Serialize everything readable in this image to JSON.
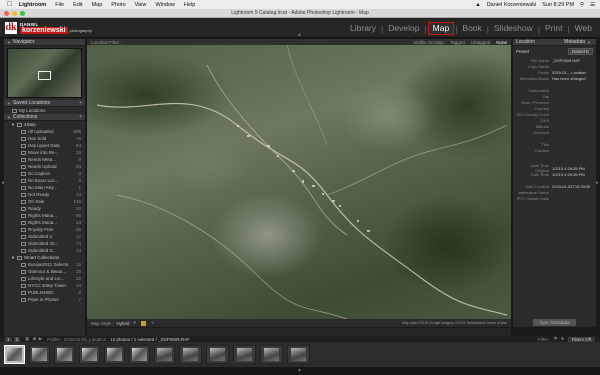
{
  "macbar": {
    "app": "Lightroom",
    "menus": [
      "File",
      "Edit",
      "Map",
      "Photo",
      "View",
      "Window",
      "Help"
    ],
    "user": "Daniel Korzeniewski",
    "time": "Sun 8:29 PM"
  },
  "window": {
    "title": "Lightroom 5 Catalog.lrcat - Adobe Photoshop Lightroom - Map"
  },
  "identity": {
    "line1": "DANIEL",
    "line2": "korzeniewski",
    "line3": "photography",
    "mark": "dk"
  },
  "modules": [
    "Library",
    "Develop",
    "Map",
    "Book",
    "Slideshow",
    "Print",
    "Web"
  ],
  "active_module": "Map",
  "left": {
    "navigator": "Navigator",
    "saved_locations": "Saved Locations",
    "my_locations": "My Locations",
    "collections": "Collections",
    "group1": "4Step",
    "items": [
      {
        "label": "All Uploaded",
        "count": "999"
      },
      {
        "label": "Has Sold",
        "count": "76"
      },
      {
        "label": "Has Upset Data",
        "count": "94"
      },
      {
        "label": "Move into Re...",
        "count": "32"
      },
      {
        "label": "Needs Meta...",
        "count": "9"
      },
      {
        "label": "Needs Upload",
        "count": "34"
      },
      {
        "label": "No Caption",
        "count": "3"
      },
      {
        "label": "No Exact Loc...",
        "count": "5"
      },
      {
        "label": "No Main Key...",
        "count": "1"
      },
      {
        "label": "Not Ready",
        "count": "24"
      },
      {
        "label": "On Sale",
        "count": "146"
      },
      {
        "label": "Ready",
        "count": "20"
      },
      {
        "label": "Rights Mana...",
        "count": "56"
      },
      {
        "label": "Rights Mana...",
        "count": "43"
      },
      {
        "label": "Royalty Free",
        "count": "25"
      },
      {
        "label": "Submitted 2",
        "count": "17"
      },
      {
        "label": "Submitted 20...",
        "count": "74"
      },
      {
        "label": "Submitted D...",
        "count": "14"
      }
    ],
    "group2": "Smart Collections",
    "items2": [
      {
        "label": "Europe2011 Selects",
        "count": "12"
      },
      {
        "label": "Glamour & Beaut...",
        "count": "19"
      },
      {
        "label": "Lifestyle and Lei...",
        "count": "32"
      },
      {
        "label": "NYCC 4step Tower",
        "count": "14"
      },
      {
        "label": "PUBLISHED",
        "count": "8"
      },
      {
        "label": "Pope in Photos",
        "count": "7"
      }
    ],
    "btn_import": "Import...",
    "btn_export": "Export..."
  },
  "map": {
    "filter_label": "Location Filter :",
    "filters": [
      "Visible On Map",
      "Tagged",
      "Untagged",
      "None"
    ],
    "active_filter": "None",
    "map_style_label": "Map Style :",
    "map_style": "Hybrid",
    "attribution": "Map data ©2015 Google Imagery ©2015 TerraMetrics Terms of Use"
  },
  "right": {
    "histogram": "Location",
    "metadata": "Metadata",
    "preset_label": "Preset",
    "preset_value": "Daniel K",
    "rows": [
      {
        "k": "File Name",
        "v": "_DSF0509.RAF"
      },
      {
        "k": "Copy Name",
        "v": ""
      },
      {
        "k": "Folder",
        "v": "2015-01-...Location"
      },
      {
        "k": "Metadata Status",
        "v": "Has been changed"
      },
      {
        "k": "",
        "v": ""
      },
      {
        "k": "Sublocation",
        "v": ""
      },
      {
        "k": "City",
        "v": ""
      },
      {
        "k": "State / Province",
        "v": ""
      },
      {
        "k": "Country",
        "v": ""
      },
      {
        "k": "ISO Country Code",
        "v": ""
      },
      {
        "k": "GPS",
        "v": ""
      },
      {
        "k": "Altitude",
        "v": ""
      },
      {
        "k": "Direction",
        "v": ""
      },
      {
        "k": "",
        "v": ""
      },
      {
        "k": "Title",
        "v": ""
      },
      {
        "k": "Caption",
        "v": ""
      },
      {
        "k": "",
        "v": ""
      },
      {
        "k": "",
        "v": ""
      },
      {
        "k": "Date Time Original",
        "v": "1/2/15 4:29:35 PM"
      },
      {
        "k": "Date Time",
        "v": "1/2/15 4:29:35 PM"
      },
      {
        "k": "",
        "v": ""
      },
      {
        "k": "Date Created",
        "v": "2015-01-02T16:29:35"
      },
      {
        "k": "Intellectual Genre",
        "v": ""
      },
      {
        "k": "IPTC Scene Code",
        "v": ""
      }
    ],
    "sync_btn": "Sync Metadata"
  },
  "filmbar": {
    "folder_text": "Folder : 2015-01-02_Location",
    "count_text": "12 photos / 1 selected / _DSF0509.RAF",
    "filter_label": "Filter :",
    "filter_value": "Filters Off"
  }
}
